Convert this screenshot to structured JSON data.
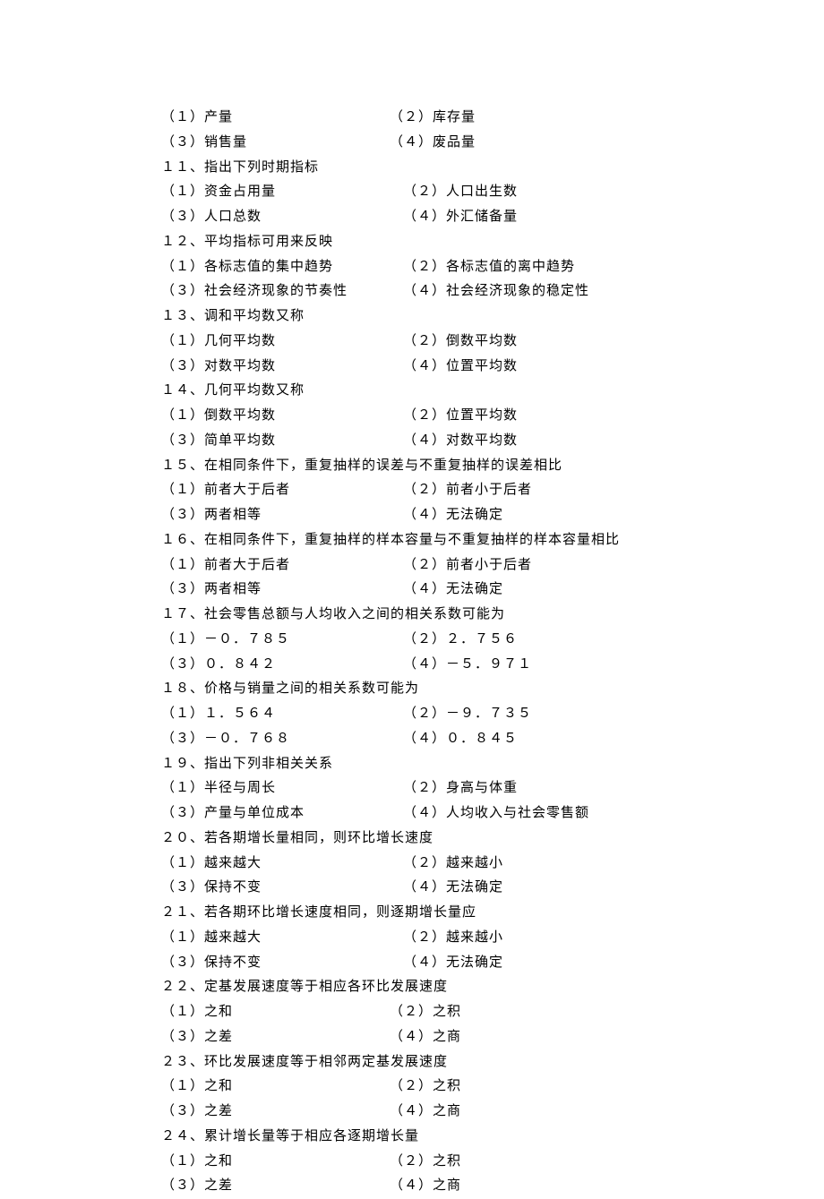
{
  "orphan": {
    "o1": "（１）产量",
    "o2": "（２）库存量",
    "o3": "（３）销售量",
    "o4": "（４）废品量"
  },
  "q11": {
    "title": "１１、指出下列时期指标",
    "o1": "（１）资金占用量",
    "o2": "（２）人口出生数",
    "o3": "（３）人口总数",
    "o4": "（４）外汇储备量"
  },
  "q12": {
    "title": "１２、平均指标可用来反映",
    "o1": "（１）各标志值的集中趋势",
    "o2": "（２）各标志值的离中趋势",
    "o3": "（３）社会经济现象的节奏性",
    "o4": "（４）社会经济现象的稳定性"
  },
  "q13": {
    "title": "１３、调和平均数又称",
    "o1": "（１）几何平均数",
    "o2": "（２）倒数平均数",
    "o3": "（３）对数平均数",
    "o4": "（４）位置平均数"
  },
  "q14": {
    "title": "１４、几何平均数又称",
    "o1": "（１）倒数平均数",
    "o2": "（２）位置平均数",
    "o3": "（３）简单平均数",
    "o4": "（４）对数平均数"
  },
  "q15": {
    "title": "１５、在相同条件下，重复抽样的误差与不重复抽样的误差相比",
    "o1": "（１）前者大于后者",
    "o2": "（２）前者小于后者",
    "o3": "（３）两者相等",
    "o4": "（４）无法确定"
  },
  "q16": {
    "title": "１６、在相同条件下，重复抽样的样本容量与不重复抽样的样本容量相比",
    "o1": "（１）前者大于后者",
    "o2": "（２）前者小于后者",
    "o3": "（３）两者相等",
    "o4": "（４）无法确定"
  },
  "q17": {
    "title": "１７、社会零售总额与人均收入之间的相关系数可能为",
    "o1": "（１）－０．７８５",
    "o2": "（２）２．７５６",
    "o3": "（３）０．８４２",
    "o4": "（４）－５．９７１"
  },
  "q18": {
    "title": "１８、价格与销量之间的相关系数可能为",
    "o1": "（１）１．５６４",
    "o2": "（２）－９．７３５",
    "o3": "（３）－０．７６８",
    "o4": "（４）０．８４５"
  },
  "q19": {
    "title": "１９、指出下列非相关关系",
    "o1": "（１）半径与周长",
    "o2": "（２）身高与体重",
    "o3": "（３）产量与单位成本",
    "o4": "（４）人均收入与社会零售额"
  },
  "q20": {
    "title": "２０、若各期增长量相同，则环比增长速度",
    "o1": "（１）越来越大",
    "o2": "（２）越来越小",
    "o3": "（３）保持不变",
    "o4": "（４）无法确定"
  },
  "q21": {
    "title": "２１、若各期环比增长速度相同，则逐期增长量应",
    "o1": "（１）越来越大",
    "o2": "（２）越来越小",
    "o3": "（３）保持不变",
    "o4": "（４）无法确定"
  },
  "q22": {
    "title": "２２、定基发展速度等于相应各环比发展速度",
    "o1": "（１）之和",
    "o2": "（２）之积",
    "o3": "（３）之差",
    "o4": "（４）之商"
  },
  "q23": {
    "title": "２３、环比发展速度等于相邻两定基发展速度",
    "o1": "（１）之和",
    "o2": "（２）之积",
    "o3": "（３）之差",
    "o4": "（４）之商"
  },
  "q24": {
    "title": "２４、累计增长量等于相应各逐期增长量",
    "o1": "（１）之和",
    "o2": "（２）之积",
    "o3": "（３）之差",
    "o4": "（４）之商"
  }
}
